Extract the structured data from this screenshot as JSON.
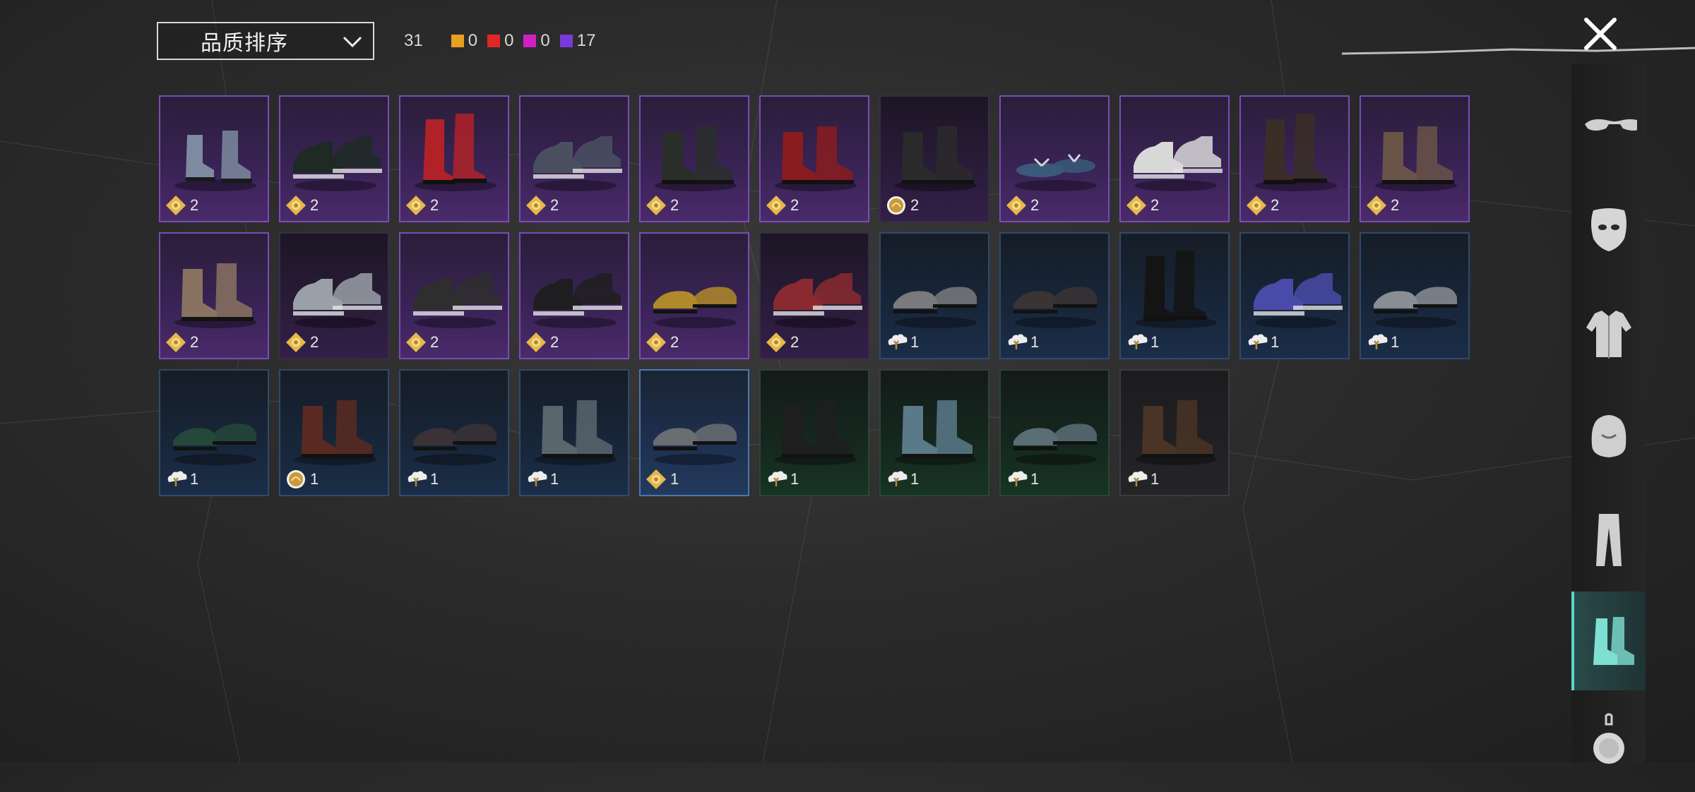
{
  "sort": {
    "label": "品质排序"
  },
  "counts": {
    "total": "31",
    "items": [
      {
        "color": "#e8a020",
        "value": "0"
      },
      {
        "color": "#e02828",
        "value": "0"
      },
      {
        "color": "#d020c0",
        "value": "0"
      },
      {
        "color": "#7a3ad8",
        "value": "17"
      }
    ]
  },
  "items": [
    {
      "rarity": "purple",
      "count": "2",
      "badge": "diamond",
      "shoe": "#7d8aa0",
      "style": "ankle"
    },
    {
      "rarity": "purple",
      "count": "2",
      "badge": "diamond",
      "shoe": "#1e2a24",
      "style": "sneaker"
    },
    {
      "rarity": "purple",
      "count": "2",
      "badge": "diamond",
      "shoe": "#b02228",
      "style": "tall"
    },
    {
      "rarity": "purple",
      "count": "2",
      "badge": "diamond",
      "shoe": "#4a5060",
      "style": "sneaker"
    },
    {
      "rarity": "purple",
      "count": "2",
      "badge": "diamond",
      "shoe": "#2a2e2a",
      "style": "boot"
    },
    {
      "rarity": "purple",
      "count": "2",
      "badge": "diamond",
      "shoe": "#8a1c1e",
      "style": "boot"
    },
    {
      "rarity": "purple dim",
      "count": "2",
      "badge": "coin",
      "shoe": "#2a2a2c",
      "style": "boot"
    },
    {
      "rarity": "purple",
      "count": "2",
      "badge": "diamond",
      "shoe": "#3a5a7a",
      "style": "sandal"
    },
    {
      "rarity": "purple",
      "count": "2",
      "badge": "diamond",
      "shoe": "#d8d8d8",
      "style": "sneaker"
    },
    {
      "rarity": "purple",
      "count": "2",
      "badge": "diamond",
      "shoe": "#3a2e26",
      "style": "tall"
    },
    {
      "rarity": "purple",
      "count": "2",
      "badge": "diamond",
      "shoe": "#6a5448",
      "style": "boot"
    },
    {
      "rarity": "purple",
      "count": "2",
      "badge": "diamond",
      "shoe": "#8a7260",
      "style": "boot"
    },
    {
      "rarity": "purple dim",
      "count": "2",
      "badge": "diamond",
      "shoe": "#9aa0a8",
      "style": "sneaker"
    },
    {
      "rarity": "purple",
      "count": "2",
      "badge": "diamond",
      "shoe": "#2e2e2e",
      "style": "sneaker"
    },
    {
      "rarity": "purple",
      "count": "2",
      "badge": "diamond",
      "shoe": "#1e1e20",
      "style": "sneaker"
    },
    {
      "rarity": "purple",
      "count": "2",
      "badge": "diamond",
      "shoe": "#b08a2a",
      "style": "loafer"
    },
    {
      "rarity": "purple dim",
      "count": "2",
      "badge": "diamond",
      "shoe": "#8a2a30",
      "style": "sneaker"
    },
    {
      "rarity": "blue",
      "count": "1",
      "badge": "cloud",
      "shoe": "#7a7a7e",
      "style": "loafer"
    },
    {
      "rarity": "blue",
      "count": "1",
      "badge": "cloud",
      "shoe": "#3a3434",
      "style": "loafer"
    },
    {
      "rarity": "blue",
      "count": "1",
      "badge": "cloud",
      "shoe": "#141414",
      "style": "tall"
    },
    {
      "rarity": "blue",
      "count": "1",
      "badge": "cloud",
      "shoe": "#4a4aa8",
      "style": "sneaker"
    },
    {
      "rarity": "blue",
      "count": "1",
      "badge": "cloud",
      "shoe": "#8a8e94",
      "style": "loafer"
    },
    {
      "rarity": "blue",
      "count": "1",
      "badge": "cloud",
      "shoe": "#24483a",
      "style": "loafer"
    },
    {
      "rarity": "blue",
      "count": "1",
      "badge": "coin",
      "shoe": "#5a2a22",
      "style": "boot"
    },
    {
      "rarity": "blue",
      "count": "1",
      "badge": "cloud",
      "shoe": "#3a3236",
      "style": "loafer"
    },
    {
      "rarity": "blue",
      "count": "1",
      "badge": "cloud",
      "shoe": "#5a666e",
      "style": "boot"
    },
    {
      "rarity": "blue bright",
      "count": "1",
      "badge": "diamond",
      "shoe": "#6a6e72",
      "style": "loafer"
    },
    {
      "rarity": "green",
      "count": "1",
      "badge": "cloud",
      "shoe": "#1e1e1e",
      "style": "boot"
    },
    {
      "rarity": "green",
      "count": "1",
      "badge": "cloud",
      "shoe": "#5a7a8a",
      "style": "boot"
    },
    {
      "rarity": "green",
      "count": "1",
      "badge": "cloud",
      "shoe": "#5a6e76",
      "style": "loafer"
    },
    {
      "rarity": "gray",
      "count": "1",
      "badge": "cloud",
      "shoe": "#4a3426",
      "style": "boot"
    }
  ],
  "sidebar": [
    {
      "name": "glasses",
      "active": false
    },
    {
      "name": "mask",
      "active": false
    },
    {
      "name": "jacket",
      "active": false
    },
    {
      "name": "backpack",
      "active": false
    },
    {
      "name": "pants",
      "active": false
    },
    {
      "name": "shoes",
      "active": true
    },
    {
      "name": "pendant",
      "active": false
    }
  ],
  "colors": {
    "accent": "#5ad6c8",
    "purple_border": "#7a4bb8",
    "blue_border": "#2e4a6e"
  }
}
